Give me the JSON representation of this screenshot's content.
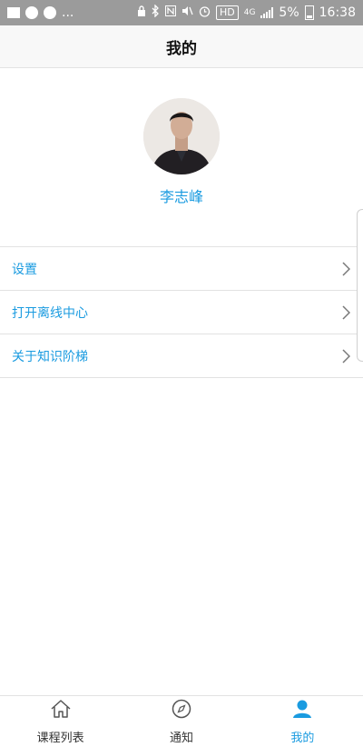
{
  "status_bar": {
    "left_icons": [
      "image-icon",
      "navigation-icon",
      "navigation-icon"
    ],
    "ellipsis": "...",
    "hd": "HD",
    "network": "4G",
    "battery_percent": "5%",
    "time": "16:38"
  },
  "header": {
    "title": "我的"
  },
  "profile": {
    "name": "李志峰"
  },
  "menu": {
    "items": [
      {
        "label": "设置",
        "icon": "chevron-right-icon"
      },
      {
        "label": "打开离线中心",
        "icon": "chevron-right-icon"
      },
      {
        "label": "关于知识阶梯",
        "icon": "chevron-right-icon"
      }
    ]
  },
  "tabs": [
    {
      "label": "课程列表",
      "icon": "home-icon",
      "active": false
    },
    {
      "label": "通知",
      "icon": "compass-icon",
      "active": false
    },
    {
      "label": "我的",
      "icon": "person-icon",
      "active": true
    }
  ],
  "colors": {
    "accent": "#1a9be0",
    "statusbar": "#9b9b9b",
    "divider": "#e2e2e2"
  }
}
